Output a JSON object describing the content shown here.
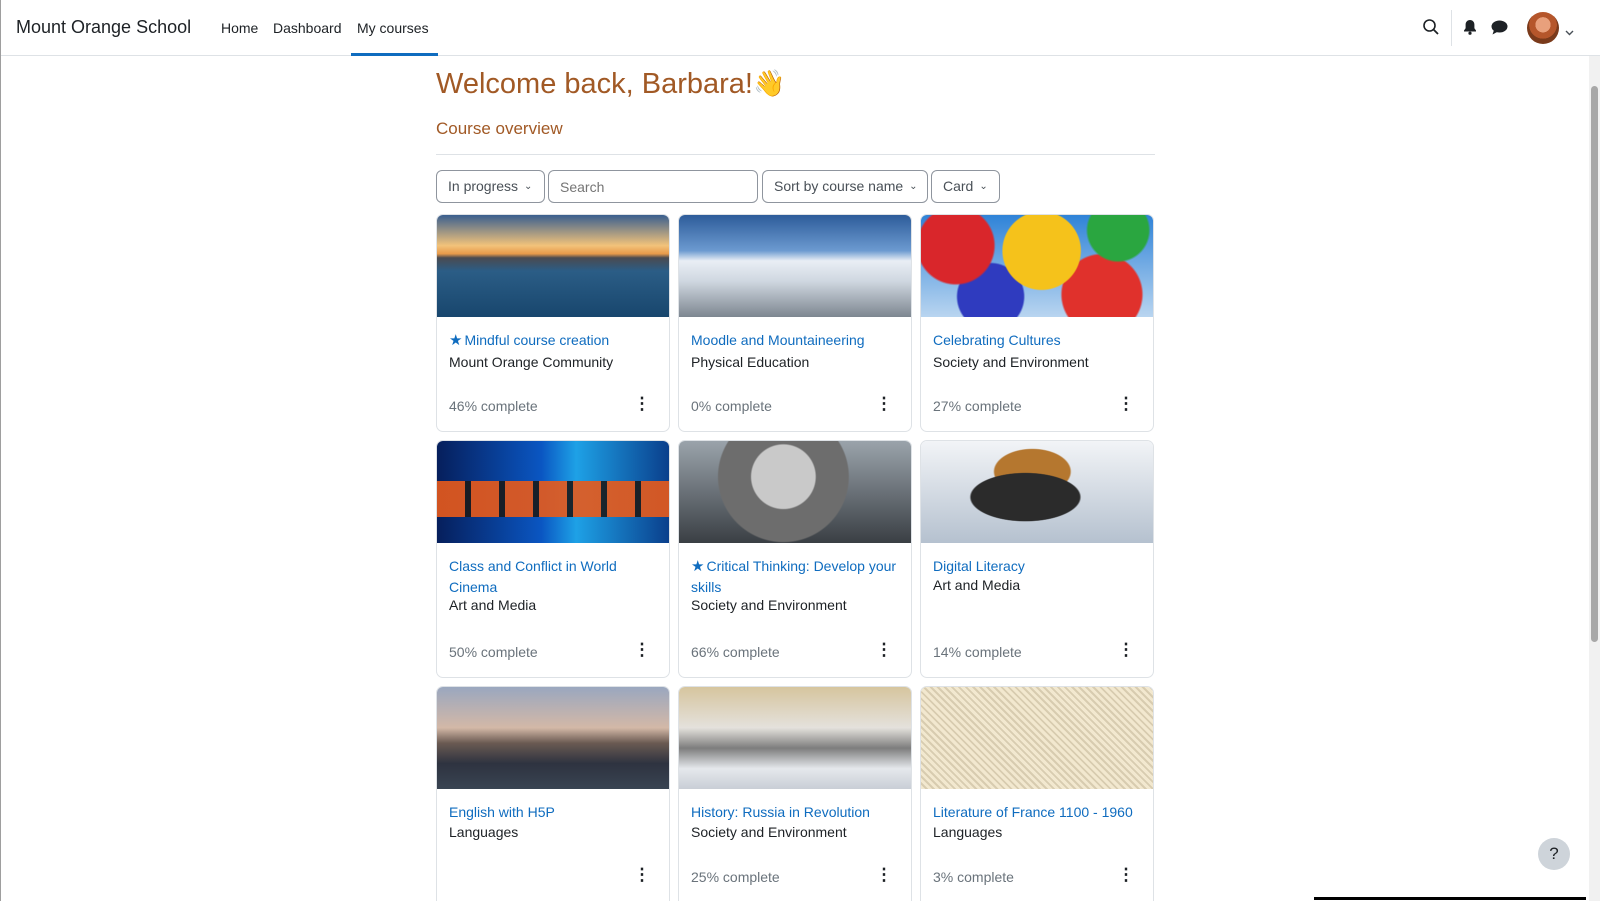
{
  "navbar": {
    "brand": "Mount Orange School",
    "links": [
      "Home",
      "Dashboard",
      "My courses"
    ],
    "active_link": "My courses"
  },
  "header": {
    "welcome": "Welcome back, Barbara!",
    "wave_emoji": "👋",
    "section_title": "Course overview"
  },
  "filters": {
    "status": "In progress",
    "search_placeholder": "Search",
    "sort": "Sort by course name",
    "view": "Card"
  },
  "courses": [
    {
      "title": "Mindful course creation",
      "category": "Mount Orange Community",
      "progress": "46% complete",
      "starred": true
    },
    {
      "title": "Moodle and Mountaineering",
      "category": "Physical Education",
      "progress": "0% complete",
      "starred": false
    },
    {
      "title": "Celebrating Cultures",
      "category": "Society and Environment",
      "progress": "27% complete",
      "starred": false
    },
    {
      "title": "Class and Conflict in World Cinema",
      "category": "Art and Media",
      "progress": "50% complete",
      "starred": false
    },
    {
      "title": "Critical Thinking: Develop your skills",
      "category": "Society and Environment",
      "progress": "66% complete",
      "starred": true
    },
    {
      "title": "Digital Literacy",
      "category": "Art and Media",
      "progress": "14% complete",
      "starred": false
    },
    {
      "title": "English with H5P",
      "category": "Languages",
      "progress": "",
      "starred": false
    },
    {
      "title": "History: Russia in Revolution",
      "category": "Society and Environment",
      "progress": "25% complete",
      "starred": false
    },
    {
      "title": "Literature of France 1100 - 1960",
      "category": "Languages",
      "progress": "3% complete",
      "starred": false
    }
  ],
  "icons": {
    "search": "search-icon",
    "notifications": "bell-icon",
    "messages": "chat-icon",
    "menu": "more-vertical-icon",
    "star": "star-icon",
    "help": "help-icon"
  },
  "help_label": "?",
  "colors": {
    "link": "#0f6cbf",
    "heading": "#a15925",
    "text": "#1d2125"
  }
}
